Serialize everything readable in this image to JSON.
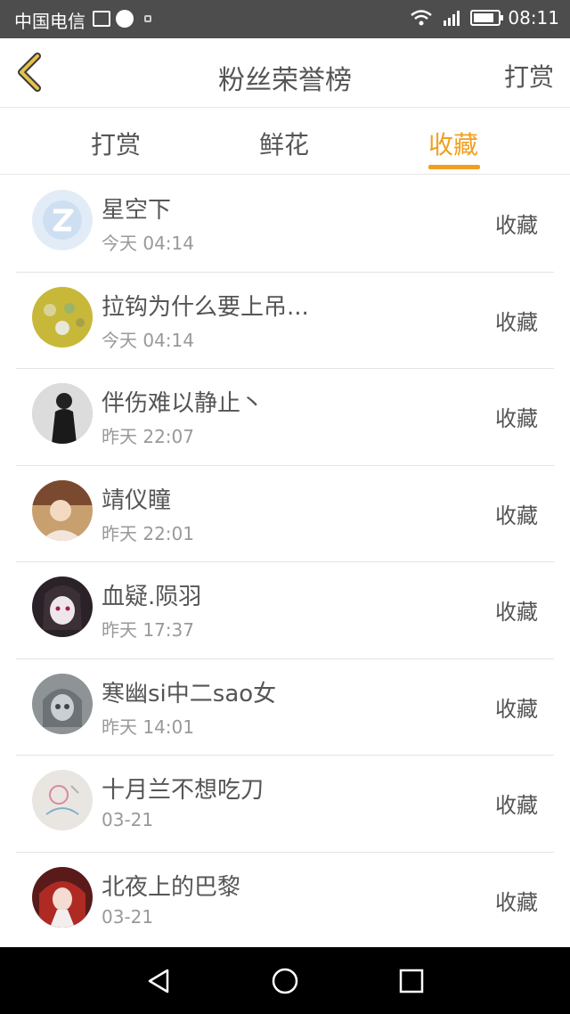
{
  "statusbar": {
    "carrier": "中国电信",
    "time": "08:11",
    "network": "4G"
  },
  "header": {
    "title": "粉丝荣誉榜",
    "action": "打赏"
  },
  "tabs": [
    {
      "label": "打赏"
    },
    {
      "label": "鲜花"
    },
    {
      "label": "收藏",
      "active": true
    }
  ],
  "accent_color": "#f0a020",
  "items": [
    {
      "name": "星空下",
      "time": "今天 04:14",
      "tag": "收藏"
    },
    {
      "name": "拉钩为什么要上吊...",
      "time": "今天 04:14",
      "tag": "收藏"
    },
    {
      "name": "伴伤难以静止丶",
      "time": "昨天 22:07",
      "tag": "收藏"
    },
    {
      "name": "靖仪瞳",
      "time": "昨天 22:01",
      "tag": "收藏"
    },
    {
      "name": "血疑.陨羽",
      "time": "昨天 17:37",
      "tag": "收藏"
    },
    {
      "name": "寒幽si中二sao女",
      "time": "昨天 14:01",
      "tag": "收藏"
    },
    {
      "name": "十月兰不想吃刀",
      "time": "03-21",
      "tag": "收藏"
    },
    {
      "name": "北夜上的巴黎",
      "time": "03-21",
      "tag": "收藏"
    }
  ]
}
